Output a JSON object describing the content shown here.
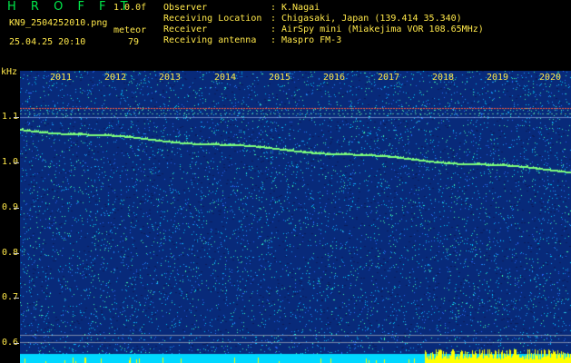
{
  "header": {
    "brand_title": "H R O F F T",
    "version": "1.0.0f",
    "filename": "KN9_2504252010.png",
    "meteor_label": "meteor",
    "datetime": "25.04.25 20:10",
    "meteor_count": "79"
  },
  "station": {
    "rows": [
      {
        "label": "Observer",
        "value": "K.Nagai"
      },
      {
        "label": "Receiving Location",
        "value": "Chigasaki, Japan (139.414 35.340)"
      },
      {
        "label": "Receiver",
        "value": "AirSpy mini (Miakejima VOR 108.65MHz)"
      },
      {
        "label": "Receiving antenna",
        "value": "Maspro FM-3"
      }
    ]
  },
  "spectrogram": {
    "axis_unit": "kHz",
    "y_ticks": [
      "1.1",
      "1.0",
      "0.9",
      "0.8",
      "0.7",
      "0.6"
    ],
    "x_ticks": [
      "2011",
      "2012",
      "2013",
      "2014",
      "2015",
      "2016",
      "2017",
      "2018",
      "2019",
      "2020"
    ],
    "background_color": "#082a7a",
    "noise_colors": [
      "#1ca0ff",
      "#00d2ff",
      "#2a6cff",
      "#40ffb0"
    ],
    "signal_color": "#7cff7c",
    "reference_line_color": "#ff5a3c",
    "bottom_band_color": "#00d8ff",
    "bottom_peak_color": "#ffff00"
  }
}
